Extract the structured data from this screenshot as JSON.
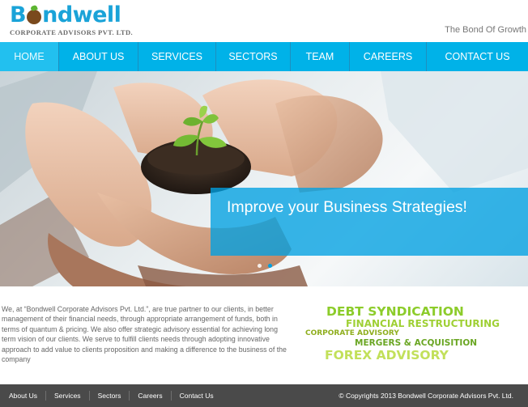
{
  "brand": {
    "logo_prefix": "B",
    "logo_suffix": "ndwell",
    "subtitle": "CORPORATE ADVISORS PVT. LTD.",
    "tagline": "The Bond Of Growth"
  },
  "nav": {
    "items": [
      {
        "label": "HOME",
        "active": true
      },
      {
        "label": "ABOUT US"
      },
      {
        "label": "SERVICES"
      },
      {
        "label": "SECTORS"
      },
      {
        "label": "TEAM"
      },
      {
        "label": "CAREERS"
      },
      {
        "label": "CONTACT US"
      }
    ]
  },
  "hero": {
    "headline": "Improve your Business Strategies!",
    "slide_count": 2,
    "active_slide": 2
  },
  "intro": {
    "text": "We, at “Bondwell Corporate Advisors Pvt. Ltd.”, are true partner to our clients, in better management of their financial needs, through appropriate arrangement of funds, both in terms of quantum & pricing. We also offer strategic advisory essential for achieving long term vision of our clients. We serve to fulfill clients needs through adopting innovative approach to add value to clients proposition and making a difference to the business of the company"
  },
  "services": [
    "DEBT SYNDICATION",
    "FINANCIAL RESTRUCTURING",
    "CORPORATE ADVISORY",
    "MERGERS & ACQUISITION",
    "FOREX ADVISORY"
  ],
  "footer": {
    "links": [
      "About Us",
      "Services",
      "Sectors",
      "Careers",
      "Contact Us"
    ],
    "copyright": "© Copyrights 2013 Bondwell Corporate Advisors Pvt. Ltd."
  },
  "colors": {
    "brand_blue": "#00b2e8",
    "logo_blue": "#1aa3d8",
    "accent_green": "#8ccc2a",
    "footer_bg": "#4a4a4a"
  }
}
